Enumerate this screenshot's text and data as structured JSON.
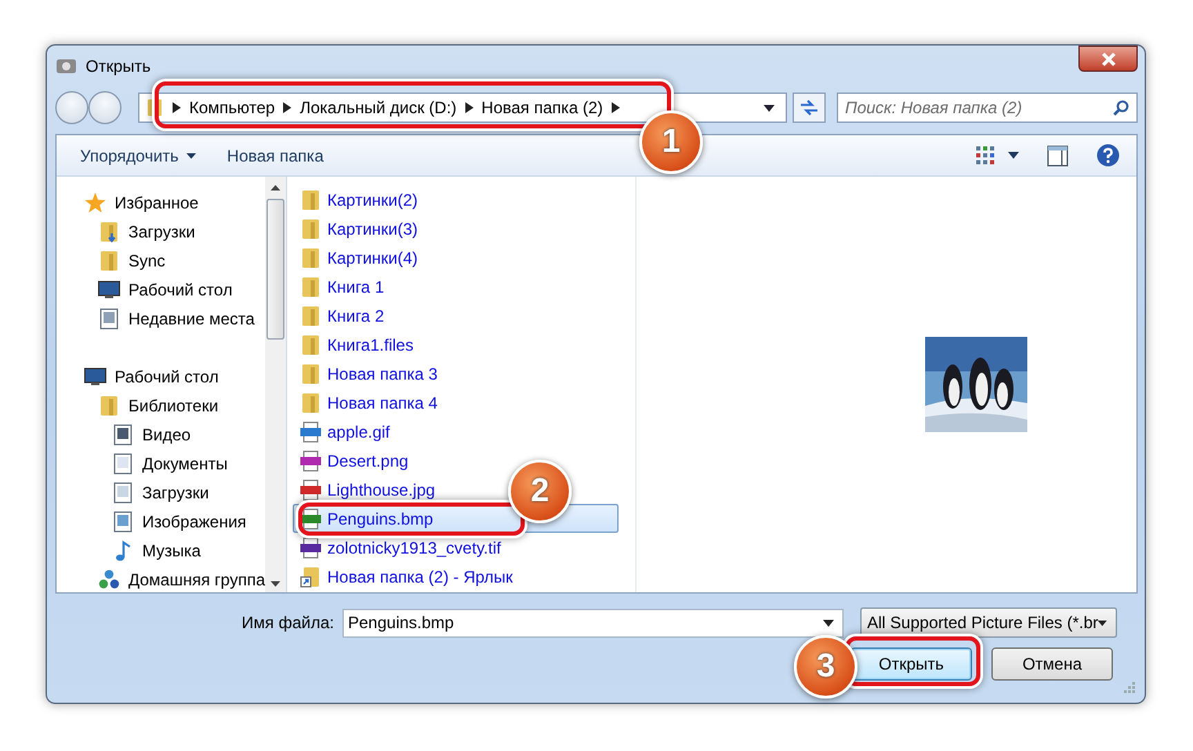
{
  "window": {
    "title": "Открыть"
  },
  "address": {
    "crumbs": [
      "Компьютер",
      "Локальный диск (D:)",
      "Новая папка (2)"
    ]
  },
  "search": {
    "placeholder": "Поиск: Новая папка (2)"
  },
  "toolbar": {
    "buttons": [
      {
        "label": "Упорядочить",
        "dropdown": true
      },
      {
        "label": "Новая папка"
      }
    ]
  },
  "nav": [
    {
      "label": "Избранное",
      "kind": "star",
      "children": [
        {
          "label": "Загрузки",
          "kind": "downloads-folder"
        },
        {
          "label": "Sync",
          "kind": "folder"
        },
        {
          "label": "Рабочий стол",
          "kind": "desktop"
        },
        {
          "label": "Недавние места",
          "kind": "recent"
        }
      ]
    },
    {
      "label": "Рабочий стол",
      "kind": "desktop",
      "children": [
        {
          "label": "Библиотеки",
          "kind": "library",
          "children": [
            {
              "label": "Видео",
              "kind": "video"
            },
            {
              "label": "Документы",
              "kind": "document"
            },
            {
              "label": "Загрузки",
              "kind": "downloads"
            },
            {
              "label": "Изображения",
              "kind": "images"
            },
            {
              "label": "Музыка",
              "kind": "music"
            }
          ]
        },
        {
          "label": "Домашняя группа",
          "kind": "homegroup"
        }
      ]
    }
  ],
  "files": [
    {
      "name": "Картинки(2)",
      "kind": "folder",
      "selected": false
    },
    {
      "name": "Картинки(3)",
      "kind": "folder",
      "selected": false
    },
    {
      "name": "Картинки(4)",
      "kind": "folder",
      "selected": false
    },
    {
      "name": "Книга 1",
      "kind": "folder",
      "selected": false
    },
    {
      "name": "Книга 2",
      "kind": "folder",
      "selected": false
    },
    {
      "name": "Книга1.files",
      "kind": "folder",
      "selected": false
    },
    {
      "name": "Новая папка 3",
      "kind": "folder",
      "selected": false
    },
    {
      "name": "Новая папка 4",
      "kind": "folder",
      "selected": false
    },
    {
      "name": "apple.gif",
      "kind": "gif",
      "selected": false
    },
    {
      "name": "Desert.png",
      "kind": "png",
      "selected": false
    },
    {
      "name": "Lighthouse.jpg",
      "kind": "jpg",
      "selected": false
    },
    {
      "name": "Penguins.bmp",
      "kind": "bmp",
      "selected": true
    },
    {
      "name": "zolotnicky1913_cvety.tif",
      "kind": "tif",
      "selected": false
    },
    {
      "name": "Новая папка (2) - Ярлык",
      "kind": "shortcut",
      "selected": false
    }
  ],
  "file_name": {
    "label": "Имя файла:",
    "value": "Penguins.bmp"
  },
  "file_type": {
    "value": "All Supported Picture Files (*.br"
  },
  "buttons": [
    {
      "label": "Открыть",
      "kind": "default"
    },
    {
      "label": "Отмена",
      "kind": "normal"
    }
  ],
  "callouts": [
    {
      "number": "1"
    },
    {
      "number": "2"
    },
    {
      "number": "3"
    }
  ]
}
